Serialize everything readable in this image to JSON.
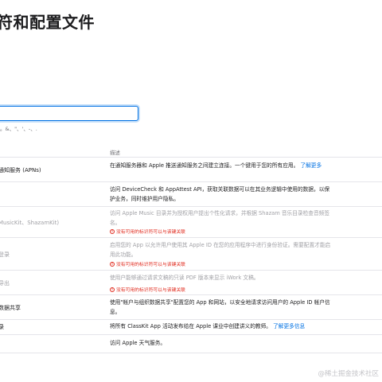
{
  "page": {
    "title": "符和配置文件"
  },
  "search": {
    "value": "",
    "hint": "。&、\"、'、-、."
  },
  "table": {
    "desc_header": "描述",
    "learn_more": "了解更多",
    "learn_more_info": "了解更多信息",
    "rows": [
      {
        "name": "通知服务 (APNs)",
        "desc": "在通知服务器和 Apple 推送通知服务之间建立连接。一个键用于您的所有应用。"
      },
      {
        "name": "",
        "desc": "访问 DeviceCheck 和 AppAttest API，获取关联数据可以在其业务逻辑中使用的数据，以保护业务，同时维护用户隐私。"
      },
      {
        "name": "MusicKit、ShazamKit)",
        "desc": "访问 Apple Music 目录并为授权用户提出个性化请求，并根据 Shazam 音乐目录检查音频签名。",
        "warning": "没有可用的标识符可以与该键关联"
      },
      {
        "name": "登录",
        "desc": "启用您的 App 以允许用户使用其 Apple ID 在您的应用程序中进行身份验证。需要配置才能启用此功能。",
        "warning": "没有可用的标识符可以与该键关联"
      },
      {
        "name": "导出",
        "desc": "使用户能够通过请求文稿的只读 PDF 版本来显示 iWork 文稿。",
        "warning": "没有可用的标识符可以与该键关联"
      },
      {
        "name": "数据共享",
        "desc": "使用\"帐户与组织数据共享\"配置您的 App 和网站，以安全地请求访问用户的 Apple ID 帐户信息。"
      },
      {
        "name": "录",
        "desc": "将所有 ClassKit App 活动发布给在 Apple 课业中创建讲义的教师。"
      },
      {
        "name": "",
        "desc": "访问 Apple 天气服务。"
      }
    ]
  },
  "watermark": "@稀土掘金技术社区",
  "colors": {
    "accent": "#0071e3",
    "warning": "#e0281b",
    "disabled_text": "#a1a1a6"
  }
}
